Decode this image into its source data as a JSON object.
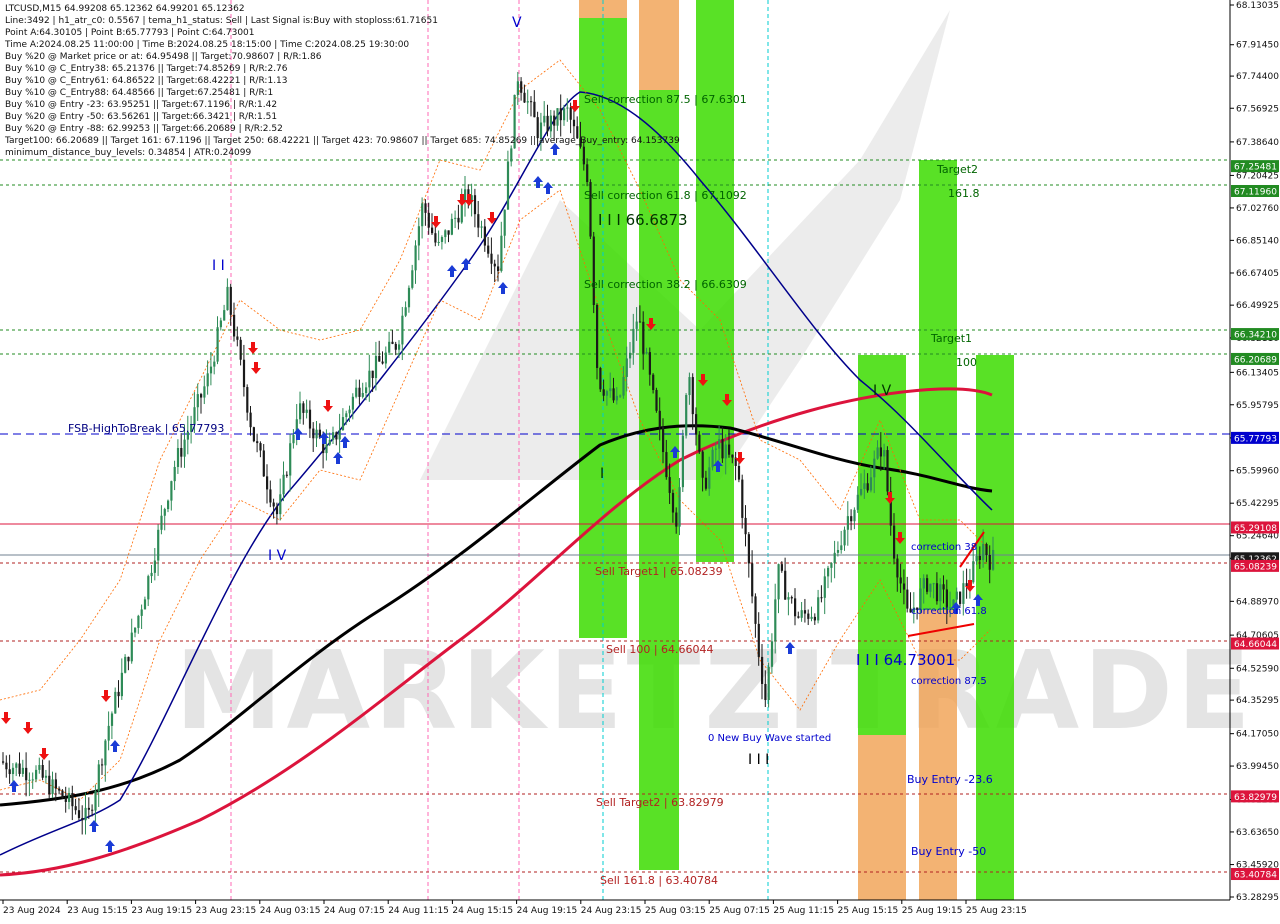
{
  "chart_data": {
    "type": "candlestick",
    "symbol_header": "LTCUSD,M15  64.99208 65.12362 64.99201 65.12362",
    "info_lines": [
      "Line:3492 | h1_atr_c0: 0.5567 | tema_h1_status: Sell | Last Signal is:Buy with stoploss:61.71651",
      "Point A:64.30105 | Point B:65.77793 | Point C:64.73001",
      "Time A:2024.08.25 11:00:00 | Time B:2024.08.25 18:15:00 | Time C:2024.08.25 19:30:00",
      "Buy %20 @ Market price or at: 64.95498 || Target:70.98607 | R/R:1.86",
      "Buy %10 @ C_Entry38: 65.21376 || Target:74.85269 | R/R:2.76",
      "Buy %10 @ C_Entry61: 64.86522 || Target:68.42221 | R/R:1.13",
      "Buy %10 @ C_Entry88: 64.48566 || Target:67.25481 | R/R:1",
      "Buy %10 @ Entry -23: 63.95251 || Target:67.1196 | R/R:1.42",
      "Buy %20 @ Entry -50: 63.56261 || Target:66.3421 | R/R:1.51",
      "Buy %20 @ Entry -88: 62.99253 || Target:66.20689 | R/R:2.52",
      "Target100: 66.20689 || Target 161: 67.1196 || Target 250: 68.42221 || Target 423: 70.98607 || Target 685: 74.85269 || average_Buy_entry: 64.153739",
      "minimum_distance_buy_levels: 0.34854 | ATR:0.24099"
    ],
    "y_ticks": [
      "68.13035",
      "67.91450",
      "67.74400",
      "67.56925",
      "67.38640",
      "67.20425",
      "67.02760",
      "66.85140",
      "66.67405",
      "66.49925",
      "66.32110",
      "66.13405",
      "65.95795",
      "65.77793",
      "65.59960",
      "65.42295",
      "65.24640",
      "65.12362",
      "64.88970",
      "64.70605",
      "64.52590",
      "64.35295",
      "64.17050",
      "63.99450",
      "63.81285",
      "63.63650",
      "63.45920",
      "63.28295"
    ],
    "x_ticks": [
      "23 Aug 2024",
      "23 Aug 15:15",
      "23 Aug 19:15",
      "23 Aug 23:15",
      "24 Aug 03:15",
      "24 Aug 07:15",
      "24 Aug 11:15",
      "24 Aug 15:15",
      "24 Aug 19:15",
      "24 Aug 23:15",
      "25 Aug 03:15",
      "25 Aug 07:15",
      "25 Aug 11:15",
      "25 Aug 15:15",
      "25 Aug 19:15",
      "25 Aug 23:15"
    ],
    "price_badges": [
      {
        "text": "67.25481",
        "color": "#228b22"
      },
      {
        "text": "67.11960",
        "color": "#228b22"
      },
      {
        "text": "66.34210",
        "color": "#228b22"
      },
      {
        "text": "66.20689",
        "color": "#228b22"
      },
      {
        "text": "65.77793",
        "color": "#0000cd"
      },
      {
        "text": "65.29108",
        "color": "#dc143c"
      },
      {
        "text": "65.12362",
        "color": "#1a1a1a"
      },
      {
        "text": "65.08239",
        "color": "#dc143c"
      },
      {
        "text": "64.66044",
        "color": "#dc143c"
      },
      {
        "text": "63.82979",
        "color": "#dc143c"
      },
      {
        "text": "63.40784",
        "color": "#dc143c"
      }
    ],
    "annotations": {
      "fsb": "FSB-HighToBreak | 65.77793",
      "sell_corr_875": "Sell correction 87.5 | 67.6301",
      "sell_corr_618": "Sell correction 61.8 | 67.1092",
      "sell_corr_382": "Sell correction 38.2 | 66.6309",
      "iii_high": "I I I 66.6873",
      "sell_target1": "Sell Target1 | 65.08239",
      "sell_100": "Sell 100 | 64.66044",
      "sell_target2": "Sell Target2 | 63.82979",
      "sell_1618": "Sell 161.8 | 63.40784",
      "target2": "Target2",
      "t1618": "161.8",
      "target1": "Target1",
      "t100": "100",
      "correction_38": "correction 38",
      "correction_618": "correction 61.8",
      "correction_875": "correction 87.5",
      "iii_low": "I I I 64.73001",
      "new_buy_wave": "0 New Buy Wave started",
      "buy_entry_236": "Buy Entry -23.6",
      "buy_entry_50": "Buy Entry -50",
      "wave_iv": "I V",
      "wave_iv2": "I V",
      "wave_ii": "I I",
      "wave_v": "V",
      "wave_iii": "I I I",
      "wave_i": "I"
    },
    "watermark": "MARKETZITRADE",
    "colors": {
      "bull_candle": "#2e8b57",
      "bear_candle": "#1a1a1a",
      "ma_fast": "#00008b",
      "ma_mid": "#000000",
      "ma_slow": "#dc143c",
      "zone_green": "#3cdc00",
      "zone_orange": "#f0a050",
      "level_green": "#228b22",
      "level_red": "#b22222",
      "level_blue": "#0000cd"
    }
  }
}
